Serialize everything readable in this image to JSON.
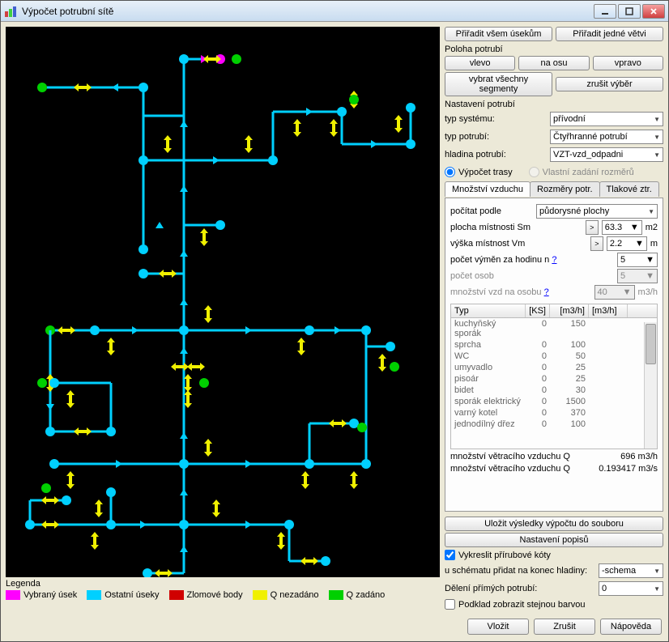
{
  "window": {
    "title": "Výpočet potrubní sítě"
  },
  "top_buttons": {
    "assign_all": "Přiřadit všem úsekům",
    "assign_one": "Přiřadit jedné větvi"
  },
  "position": {
    "group": "Poloha potrubí",
    "left": "vlevo",
    "axis": "na osu",
    "right": "vpravo",
    "select_all": "vybrat všechny segmenty",
    "deselect": "zrušit výběr"
  },
  "settings": {
    "group": "Nastavení potrubí",
    "system_label": "typ systému:",
    "system_value": "přívodní",
    "pipe_label": "typ potrubí:",
    "pipe_value": "Čtyřhranné potrubí",
    "level_label": "hladina potrubí:",
    "level_value": "VZT-vzd_odpadni"
  },
  "radio": {
    "route": "Výpočet trasy",
    "custom": "Vlastní zadání rozměrů"
  },
  "tabs": {
    "air": "Množství vzduchu",
    "dims": "Rozměry potr.",
    "loss": "Tlakové ztr."
  },
  "air": {
    "calc_by": "počítat podle",
    "calc_by_value": "půdorysné plochy",
    "area_label": "plocha místnosti Sm",
    "area_value": "63.3",
    "area_unit": "m2",
    "height_label": "výška místnost Vm",
    "height_value": "2.2",
    "height_unit": "m",
    "exchanges_label": "počet výměn za hodinu n",
    "exchanges_link": "?",
    "exchanges_value": "5",
    "persons_label": "počet osob",
    "persons_value": "5",
    "air_person_label": "množství vzd na osobu",
    "air_person_link": "?",
    "air_person_value": "40",
    "air_person_unit": "m3/h",
    "table": {
      "cols": [
        "Typ",
        "[KS]",
        "[m3/h]",
        "[m3/h]"
      ],
      "rows": [
        [
          "kuchyňský sporák",
          "0",
          "150",
          ""
        ],
        [
          "sprcha",
          "0",
          "100",
          ""
        ],
        [
          "WC",
          "0",
          "50",
          ""
        ],
        [
          "umyvadlo",
          "0",
          "25",
          ""
        ],
        [
          "pisoár",
          "0",
          "25",
          ""
        ],
        [
          "bidet",
          "0",
          "30",
          ""
        ],
        [
          "sporák elektrický",
          "0",
          "1500",
          ""
        ],
        [
          "varný kotel",
          "0",
          "370",
          ""
        ],
        [
          "jednodílný dřez",
          "0",
          "100",
          ""
        ]
      ]
    },
    "q_label": "množství větracího vzduchu Q",
    "q_m3h": "696 m3/h",
    "q_m3s": "0.193417 m3/s"
  },
  "bottom": {
    "save_results": "Uložit výsledky výpočtu do souboru",
    "label_settings": "Nastavení popisů",
    "draw_flanges": "Vykreslit přírubové kóty",
    "schema_label": "u schématu přidat na konec hladiny:",
    "schema_value": "-schema",
    "split_label": "Dělení přímých potrubí:",
    "split_value": "0",
    "same_color": "Podklad zobrazit stejnou barvou",
    "insert": "Vložit",
    "cancel": "Zrušit",
    "help": "Nápověda"
  },
  "legend": {
    "title": "Legenda",
    "items": [
      {
        "color": "#ff00ff",
        "label": "Vybraný úsek"
      },
      {
        "color": "#00d0ff",
        "label": "Ostatní úseky"
      },
      {
        "color": "#d00000",
        "label": "Zlomové body"
      },
      {
        "color": "#f0f000",
        "label": "Q nezadáno"
      },
      {
        "color": "#00d000",
        "label": "Q zadáno"
      }
    ]
  },
  "colors": {
    "cyan": "#00d0ff",
    "green": "#00d000",
    "magenta": "#ff00ff",
    "yellow": "#f0f000",
    "red": "#d00000"
  }
}
